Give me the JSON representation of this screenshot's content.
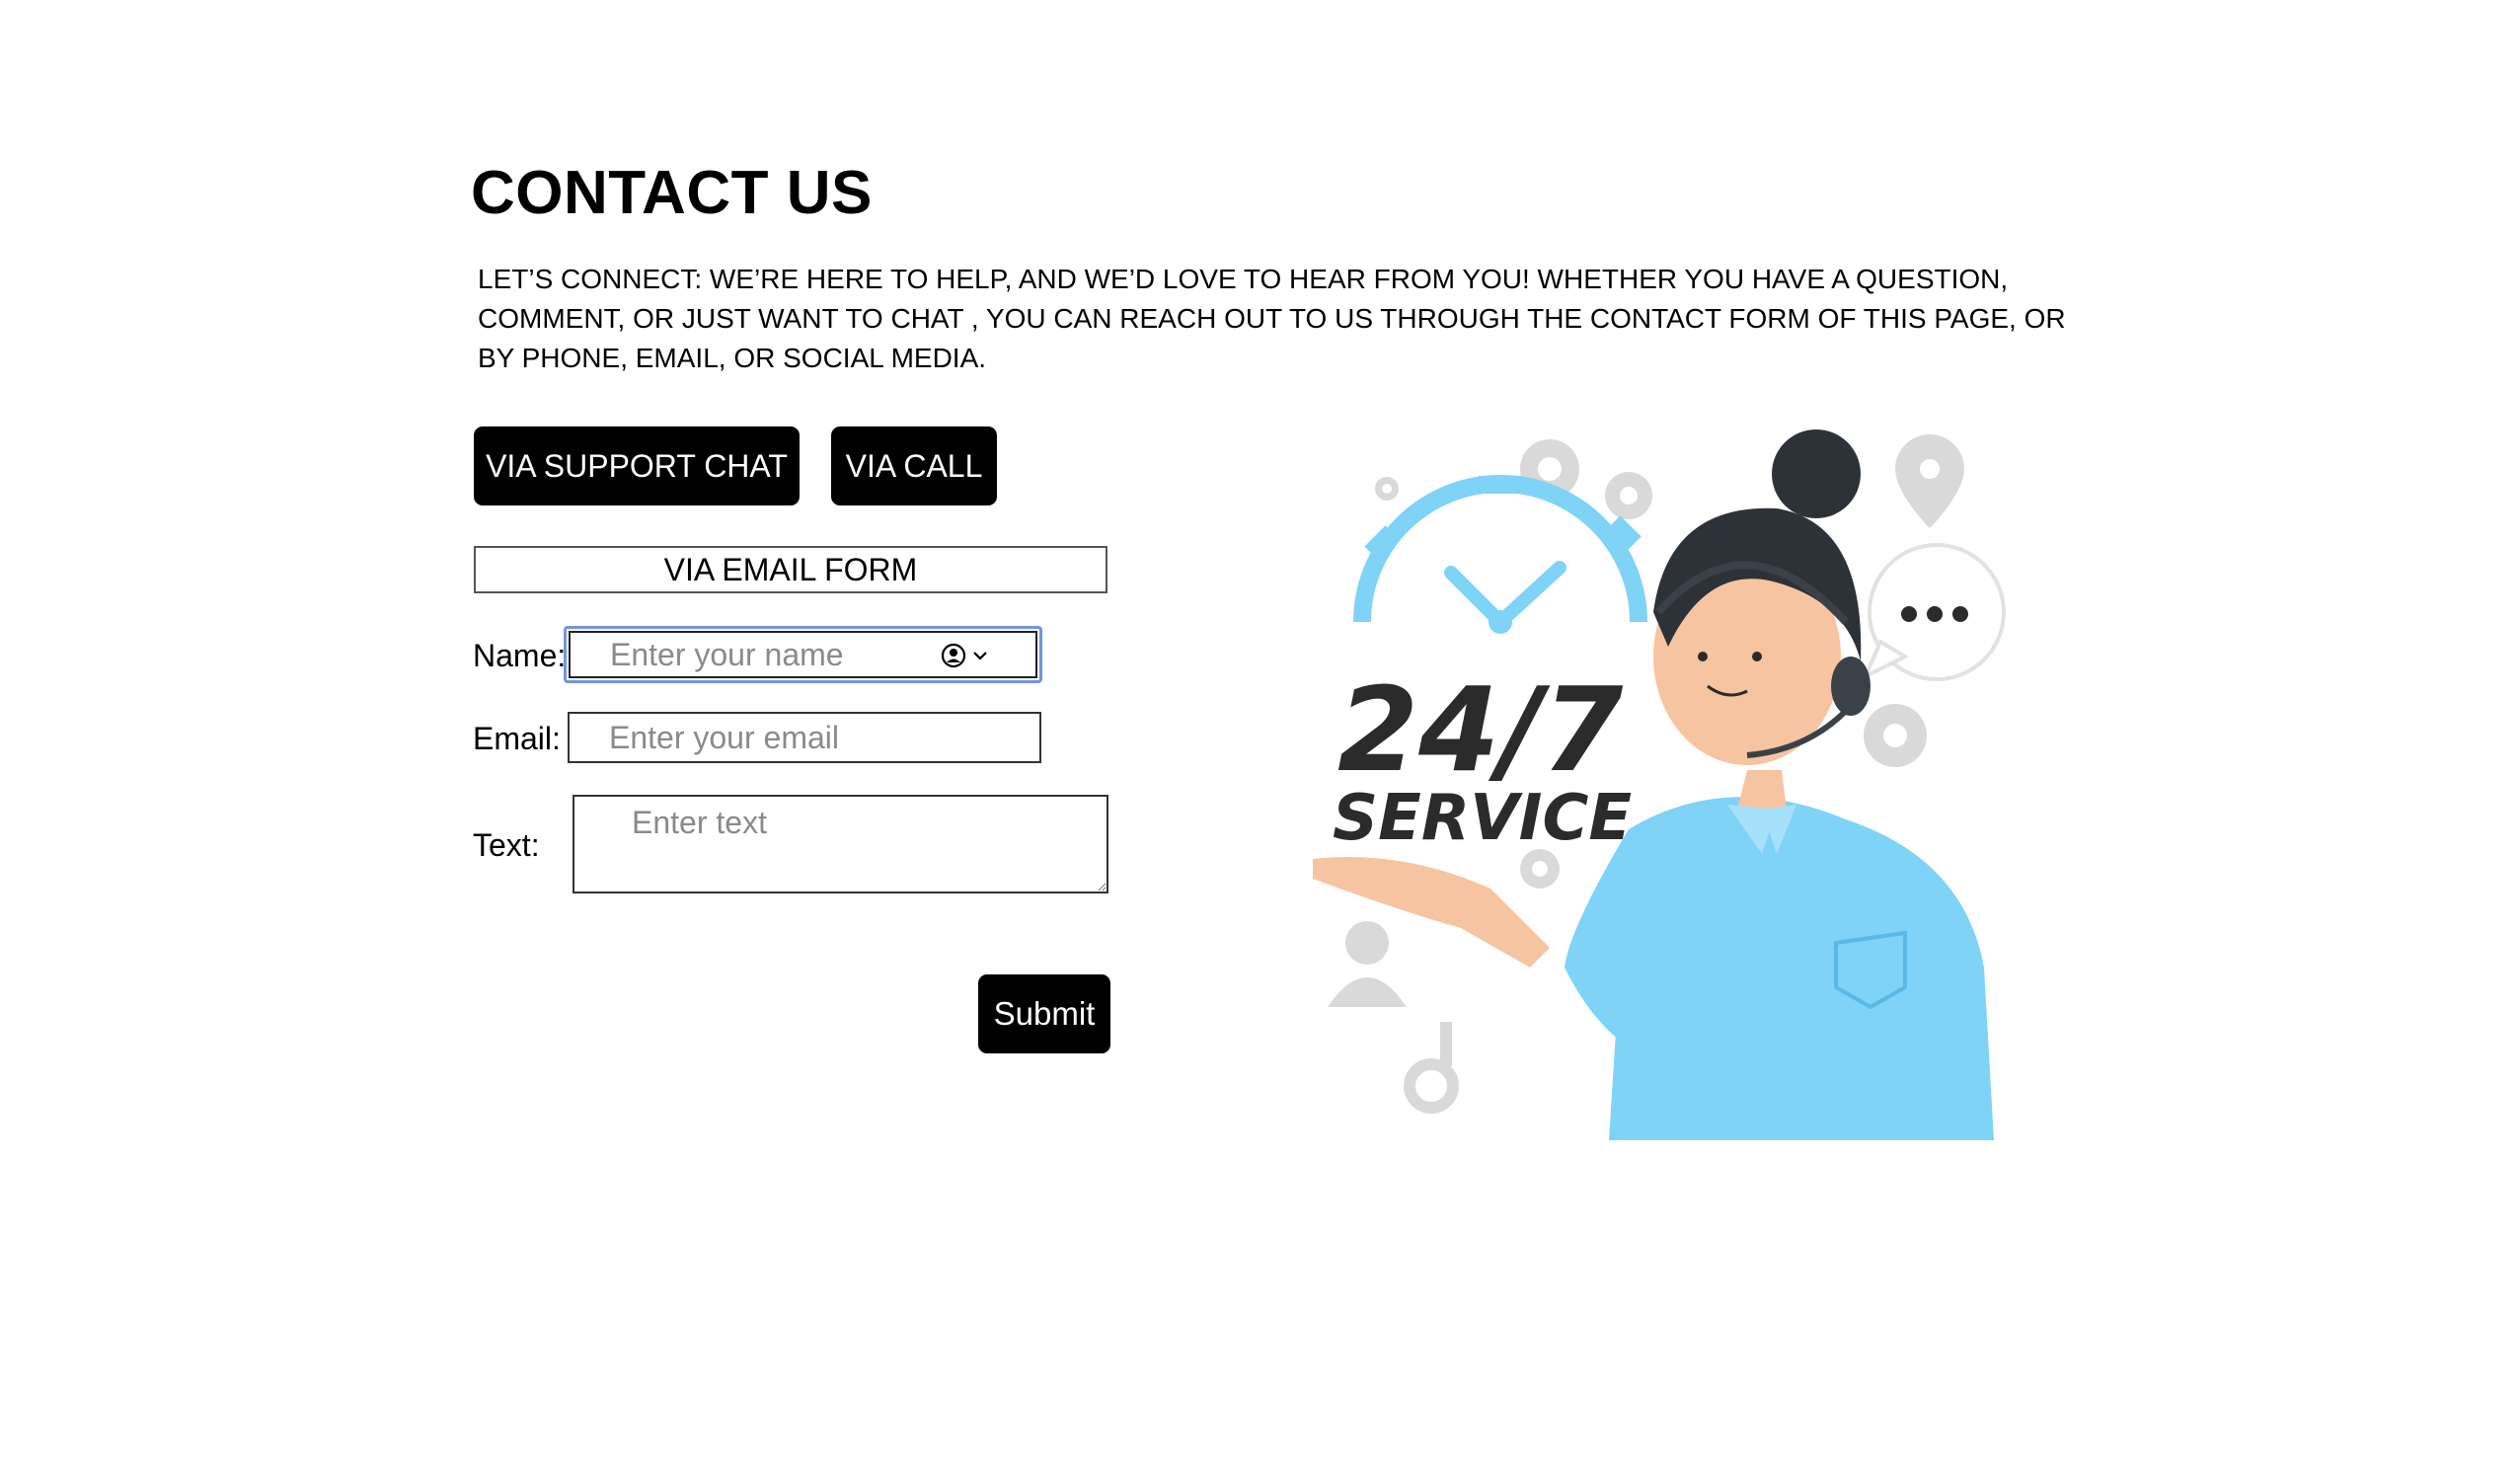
{
  "page": {
    "title": "CONTACT US",
    "intro": "LET’S CONNECT: WE’RE HERE TO HELP, AND WE’D LOVE TO HEAR FROM YOU! WHETHER YOU HAVE A QUESTION, COMMENT, OR JUST WANT TO CHAT , YOU CAN REACH OUT TO US THROUGH THE CONTACT FORM OF THIS PAGE, OR BY PHONE, EMAIL, OR SOCIAL MEDIA."
  },
  "contact_options": {
    "chat_label": "VIA SUPPORT CHAT",
    "call_label": "VIA CALL"
  },
  "email_form": {
    "header": "VIA EMAIL FORM",
    "name_label": "Name:",
    "name_placeholder": "Enter your name",
    "email_label": "Email:",
    "email_placeholder": "Enter your email",
    "text_label": "Text:",
    "text_placeholder": "Enter text",
    "submit_label": "Submit"
  },
  "illustration": {
    "headline": "24/7",
    "subline": "SERVICE",
    "colors": {
      "accent_blue": "#7fd3f7",
      "dark_text": "#2b2b2b",
      "skin": "#f7c4a1",
      "hair": "#2d3238",
      "gear_gray": "#d9d9d9"
    }
  },
  "colors": {
    "button_bg": "#000000",
    "button_text": "#ffffff",
    "focus_ring": "#6f95e6",
    "placeholder": "#8a8a8a"
  }
}
